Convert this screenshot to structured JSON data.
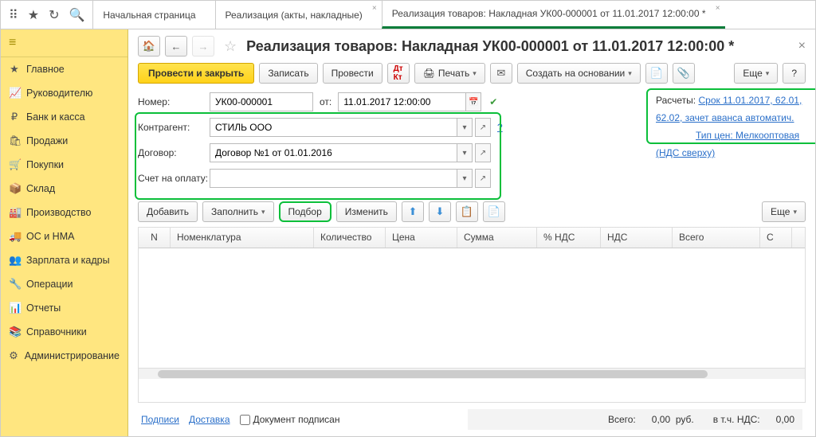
{
  "tabs": {
    "t0": "Начальная страница",
    "t1": "Реализация (акты, накладные)",
    "t2": "Реализация товаров: Накладная УК00-000001 от 11.01.2017 12:00:00 *"
  },
  "sidebar": {
    "main": "Главное",
    "manager": "Руководителю",
    "bank": "Банк и касса",
    "sales": "Продажи",
    "purchases": "Покупки",
    "warehouse": "Склад",
    "production": "Производство",
    "assets": "ОС и НМА",
    "salary": "Зарплата и кадры",
    "operations": "Операции",
    "reports": "Отчеты",
    "refs": "Справочники",
    "admin": "Администрирование"
  },
  "title": "Реализация товаров: Накладная УК00-000001 от 11.01.2017 12:00:00 *",
  "toolbar": {
    "post_close": "Провести и закрыть",
    "save": "Записать",
    "post": "Провести",
    "print": "Печать",
    "create_based": "Создать на основании",
    "more": "Еще",
    "help": "?"
  },
  "form": {
    "number_lbl": "Номер:",
    "number_val": "УК00-000001",
    "from_lbl": "от:",
    "date_val": "11.01.2017 12:00:00",
    "counterparty_lbl": "Контрагент:",
    "counterparty_val": "СТИЛЬ ООО",
    "contract_lbl": "Договор:",
    "contract_val": "Договор №1 от 01.01.2016",
    "invoice_lbl": "Счет на оплату:",
    "invoice_val": "",
    "calc_lbl": "Расчеты:",
    "calc_link": "Срок 11.01.2017, 62.01, 62.02, зачет аванса автоматич.",
    "price_type_link": "Тип цен: Мелкооптовая (НДС сверху)",
    "q": "?"
  },
  "tbl_toolbar": {
    "add": "Добавить",
    "fill": "Заполнить",
    "pick": "Подбор",
    "edit": "Изменить",
    "more": "Еще"
  },
  "grid": {
    "c0": "N",
    "c1": "Номенклатура",
    "c2": "Количество",
    "c3": "Цена",
    "c4": "Сумма",
    "c5": "% НДС",
    "c6": "НДС",
    "c7": "Всего",
    "c8": "С"
  },
  "footer": {
    "sign": "Подписи",
    "delivery": "Доставка",
    "doc_signed": "Документ подписан",
    "total_lbl": "Всего:",
    "total_val": "0,00",
    "rub": "руб.",
    "vat_lbl": "в т.ч. НДС:",
    "vat_val": "0,00"
  }
}
